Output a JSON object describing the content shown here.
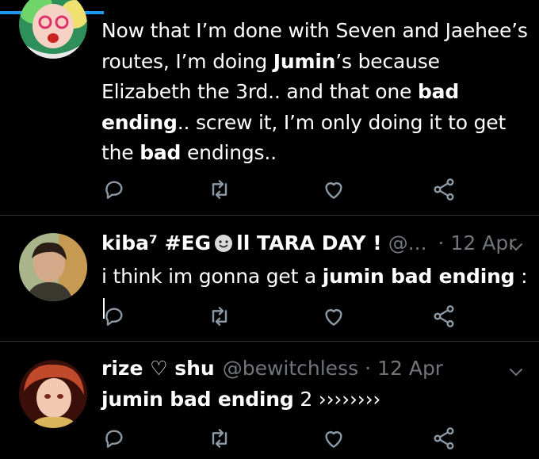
{
  "tweets": [
    {
      "text_parts": [
        "Now that I’m done with Seven and Jaehee’s routes, I’m doing ",
        "Jumin",
        "’s because Elizabeth the 3rd.. and that one ",
        "bad ending",
        ".. screw it, I’m only doing it to get the ",
        "bad",
        " endings.."
      ]
    },
    {
      "display_name": "kiba⁷ #EG",
      "display_name_tail": "ll TARA DAY !",
      "handle": "@...",
      "separator": "·",
      "time": "12 Apr",
      "text_parts": [
        "i think im gonna get a ",
        "jumin bad ending",
        " :"
      ]
    },
    {
      "display_name": "rize ♡ shu",
      "handle": "@bewitchless",
      "separator": "·",
      "time": "12 Apr",
      "text_parts": [
        "jumin bad ending",
        " 2 ››››››››"
      ]
    }
  ],
  "icons": {
    "reply": "reply-icon",
    "retweet": "retweet-icon",
    "like": "heart-icon",
    "share": "share-icon",
    "more": "chevron-down-icon"
  },
  "colors": {
    "background": "#000000",
    "text": "#ffffff",
    "muted": "#71767b",
    "divider": "#2f3336",
    "accent": "#1d9bf0"
  }
}
